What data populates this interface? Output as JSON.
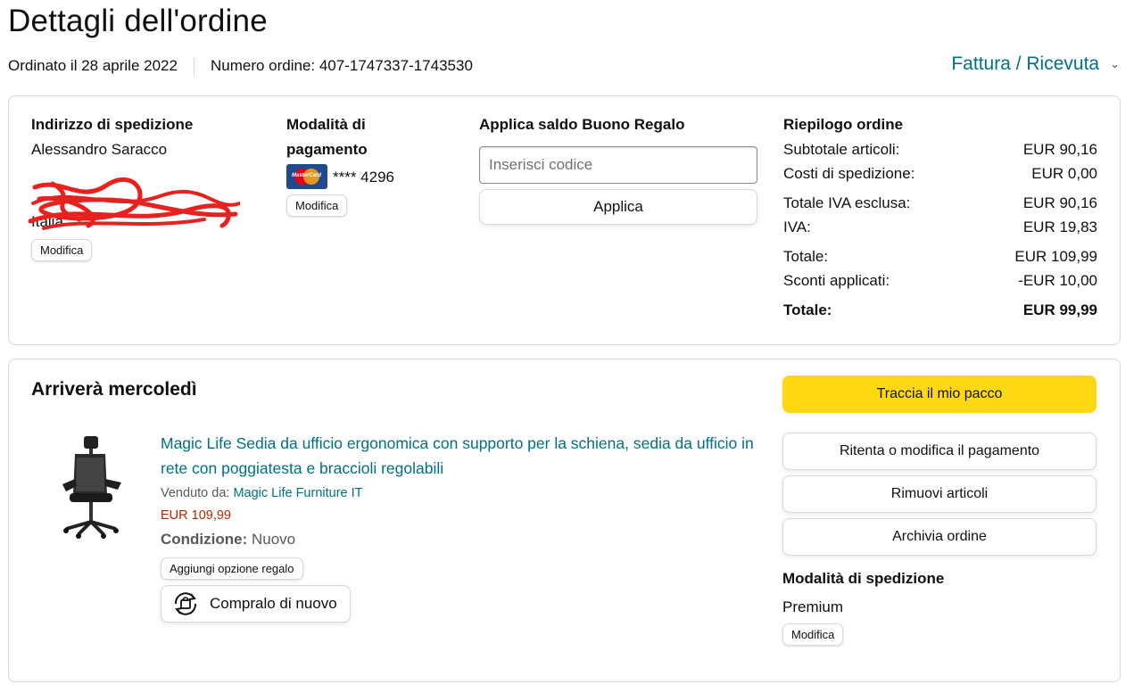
{
  "header": {
    "title": "Dettagli dell'ordine",
    "ordered_on": "Ordinato il 28 aprile 2022",
    "order_number": "Numero ordine: 407-1747337-1743530",
    "invoice_link": "Fattura / Ricevuta"
  },
  "shipping_address": {
    "title": "Indirizzo di spedizione",
    "name": "Alessandro Saracco",
    "country": "Italia",
    "edit_label": "Modifica"
  },
  "payment": {
    "title": "Modalità di pagamento",
    "card_masked": "**** 4296",
    "card_brand_icon": "mastercard-icon",
    "edit_label": "Modifica"
  },
  "gift_card": {
    "title": "Applica saldo Buono Regalo",
    "input_placeholder": "Inserisci codice",
    "apply_label": "Applica"
  },
  "summary": {
    "title": "Riepilogo ordine",
    "rows": [
      {
        "label": "Subtotale articoli:",
        "value": "EUR 90,16"
      },
      {
        "label": "Costi di spedizione:",
        "value": "EUR 0,00"
      },
      {
        "label": "Totale IVA esclusa:",
        "value": "EUR 90,16"
      },
      {
        "label": "IVA:",
        "value": "EUR 19,83"
      },
      {
        "label": "Totale:",
        "value": "EUR 109,99"
      },
      {
        "label": "Sconti applicati:",
        "value": "-EUR 10,00"
      }
    ],
    "grand_total_label": "Totale:",
    "grand_total_value": "EUR 99,99"
  },
  "shipment": {
    "arrival": "Arriverà mercoledì",
    "product": {
      "title": "Magic Life Sedia da ufficio ergonomica con supporto per la schiena, sedia da ufficio in rete con poggiatesta e braccioli regolabili",
      "sold_by_label": "Venduto da:",
      "seller": "Magic Life Furniture IT",
      "price": "EUR 109,99",
      "condition_label": "Condizione:",
      "condition_value": "Nuovo",
      "gift_option_label": "Aggiungi opzione regalo",
      "buy_again_label": "Compralo di nuovo"
    },
    "actions": {
      "track": "Traccia il mio pacco",
      "retry_payment": "Ritenta o modifica il pagamento",
      "remove_items": "Rimuovi articoli",
      "archive": "Archivia ordine"
    },
    "shipping_method": {
      "title": "Modalità di spedizione",
      "value": "Premium",
      "edit_label": "Modifica"
    }
  },
  "colors": {
    "link": "#007185",
    "price": "#b12704",
    "primary_button": "#ffd814",
    "border": "#d5d9d9"
  }
}
